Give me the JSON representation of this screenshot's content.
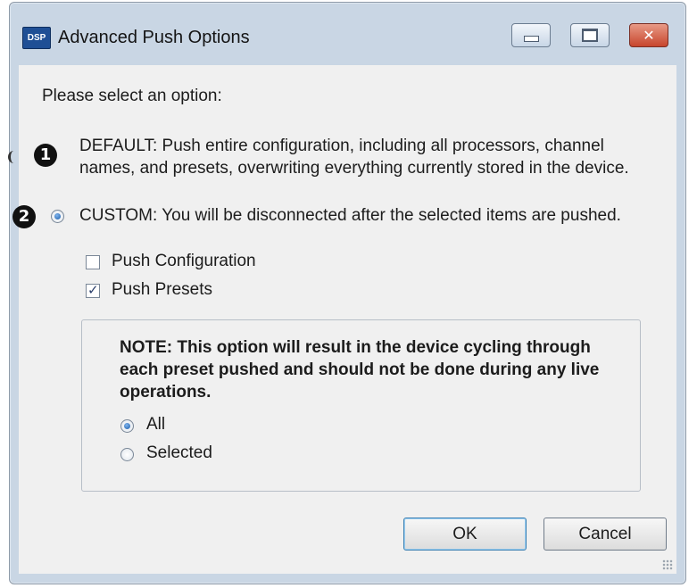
{
  "window": {
    "app_icon_text": "DSP",
    "title": "Advanced Push Options",
    "controls": {
      "minimize": "minimize-icon",
      "maximize": "maximize-icon",
      "close": "close-icon"
    }
  },
  "prompt": "Please select an option:",
  "markers": {
    "first": "1",
    "second": "2"
  },
  "options": {
    "default": {
      "text": "DEFAULT:  Push entire configuration, including all processors, channel names, and presets, overwriting everything currently stored in the device.",
      "selected": false
    },
    "custom": {
      "text": "CUSTOM: You will be disconnected after the selected items are pushed.",
      "selected": true
    }
  },
  "checkboxes": {
    "push_configuration": {
      "label": "Push Configuration",
      "checked": false
    },
    "push_presets": {
      "label": "Push Presets",
      "checked": true
    }
  },
  "note": {
    "text": "NOTE: This option will result in the device cycling through each preset pushed and should not be done during any live operations.",
    "all": {
      "label": "All",
      "selected": true
    },
    "selected": {
      "label": "Selected",
      "selected": false
    }
  },
  "buttons": {
    "ok": "OK",
    "cancel": "Cancel"
  },
  "colors": {
    "titlebar": "#c9d6e4",
    "client": "#f0f0f0",
    "close_button": "#c7452c",
    "radio_dot": "#1b5ca8"
  }
}
